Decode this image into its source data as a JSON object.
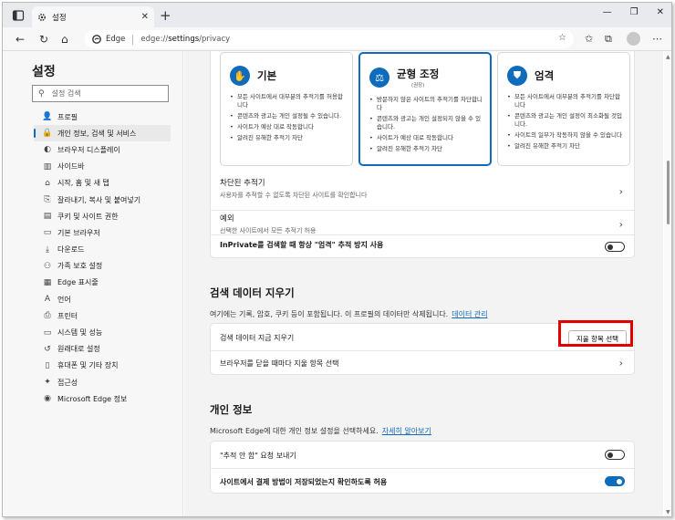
{
  "titlebar": {
    "tab_title": "설정",
    "tab_close": "✕",
    "new_tab": "+",
    "minimize": "—",
    "restore": "❐",
    "close": "✕"
  },
  "addressbar": {
    "site_label": "Edge",
    "url_prefix": "edge://",
    "url_host": "settings",
    "url_path": "/privacy"
  },
  "sidebar": {
    "title": "설정",
    "search_placeholder": "설정 검색",
    "items": [
      {
        "label": "프로필",
        "icon": "profile-icon",
        "glyph": "👤"
      },
      {
        "label": "개인 정보, 검색 및 서비스",
        "icon": "lock-icon",
        "glyph": "🔒",
        "active": true
      },
      {
        "label": "브라우저 디스플레이",
        "icon": "appearance-icon",
        "glyph": "◐"
      },
      {
        "label": "사이드바",
        "icon": "sidebar-icon",
        "glyph": "▥"
      },
      {
        "label": "시작, 홈 및 새 탭",
        "icon": "home-icon",
        "glyph": "⌂"
      },
      {
        "label": "잘라내기, 복사 및 붙여넣기",
        "icon": "share-icon",
        "glyph": "⎘"
      },
      {
        "label": "쿠키 및 사이트 권한",
        "icon": "cookie-icon",
        "glyph": "▤"
      },
      {
        "label": "기본 브라우저",
        "icon": "browser-icon",
        "glyph": "▭"
      },
      {
        "label": "다운로드",
        "icon": "download-icon",
        "glyph": "⤓"
      },
      {
        "label": "가족 보호 설정",
        "icon": "family-icon",
        "glyph": "⚇"
      },
      {
        "label": "Edge 표시줄",
        "icon": "edge-bar-icon",
        "glyph": "▦"
      },
      {
        "label": "언어",
        "icon": "language-icon",
        "glyph": "A"
      },
      {
        "label": "프린터",
        "icon": "printer-icon",
        "glyph": "⎙"
      },
      {
        "label": "시스템 및 성능",
        "icon": "system-icon",
        "glyph": "▭"
      },
      {
        "label": "원래대로 설정",
        "icon": "reset-icon",
        "glyph": "↺"
      },
      {
        "label": "휴대폰 및 기타 장치",
        "icon": "phone-icon",
        "glyph": "▯"
      },
      {
        "label": "접근성",
        "icon": "accessibility-icon",
        "glyph": "✦"
      },
      {
        "label": "Microsoft Edge 정보",
        "icon": "edge-logo-icon",
        "glyph": "◉"
      }
    ]
  },
  "tracking": {
    "cards": [
      {
        "title": "기본",
        "subtitle": "",
        "icon_glyph": "✋",
        "selected": false,
        "bullets": [
          "모든 사이트에서 대부분의 추적기를 허용합니다",
          "콘텐츠와 광고는 개인 설정될 수 있습니다.",
          "사이트가 예상 대로 작동합니다",
          "알려진 유해한 추적기 차단"
        ]
      },
      {
        "title": "균형 조정",
        "subtitle": "(권장)",
        "icon_glyph": "⚖",
        "selected": true,
        "bullets": [
          "방문하지 않은 사이트의 추적기를 차단합니다",
          "콘텐츠와 광고는 개인 설정되지 않을 수 있습니다.",
          "사이트가 예상 대로 작동합니다",
          "알려진 유해한 추적기 차단"
        ]
      },
      {
        "title": "엄격",
        "subtitle": "",
        "icon_glyph": "⛊",
        "selected": false,
        "bullets": [
          "모든 사이트에서 대부분의 추적기를 차단합니다",
          "콘텐츠와 광고는 개인 설정이 최소화될 것입니다.",
          "사이트의 일부가 작동하지 않을 수 있습니다",
          "알려진 유해한 추적기 차단"
        ]
      }
    ],
    "blocked_title": "차단된 추적기",
    "blocked_desc": "사용자를 추적할 수 없도록 차단된 사이트를 확인합니다",
    "exceptions_title": "예외",
    "exceptions_desc": "선택한 사이트에서 모든 추적기 허용",
    "inprivate_label": "InPrivate를 검색할 때 항상 \"엄격\" 추적 방지 사용",
    "inprivate_on": false
  },
  "clear_data": {
    "title": "검색 데이터 지우기",
    "desc": "여기에는 기록, 암호, 쿠키 등이 포함됩니다. 이 프로필의 데이터만 삭제됩니다.",
    "manage_link": "데이터 관리",
    "clear_now_label": "검색 데이터 지금 지우기",
    "choose_button": "지울 항목 선택",
    "on_close_label": "브라우저를 닫을 때마다 지울 항목 선택"
  },
  "privacy": {
    "title": "개인 정보",
    "desc": "Microsoft Edge에 대한 개인 정보 설정을 선택하세요.",
    "learn_more": "자세히 알아보기",
    "dnt_label": "\"추적 안 함\" 요청 보내기",
    "dnt_on": false,
    "payment_label": "사이트에서 결제 방법이 저장되었는지 확인하도록 허용",
    "payment_on": true
  },
  "colors": {
    "accent": "#0f6cbd",
    "highlight": "#e00000"
  }
}
